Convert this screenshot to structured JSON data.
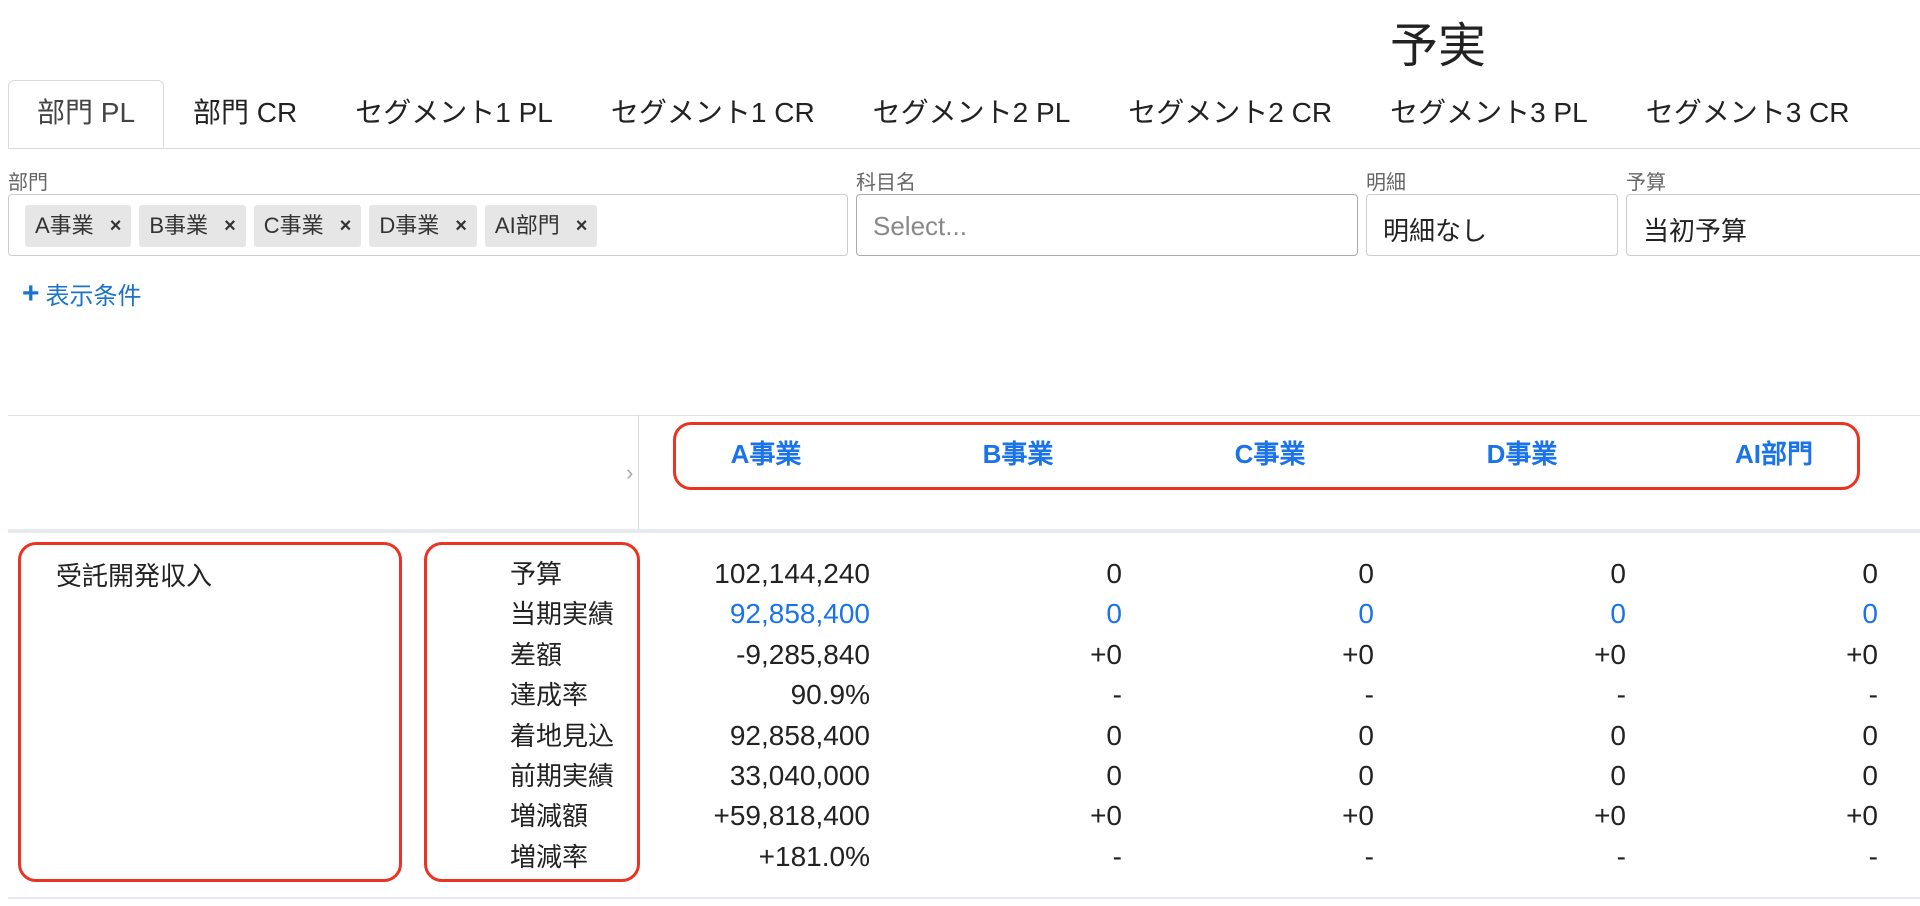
{
  "page_title": "予実",
  "tabs": [
    {
      "label": "部門 PL",
      "active": true
    },
    {
      "label": "部門 CR",
      "active": false
    },
    {
      "label": "セグメント1 PL",
      "active": false
    },
    {
      "label": "セグメント1 CR",
      "active": false
    },
    {
      "label": "セグメント2 PL",
      "active": false
    },
    {
      "label": "セグメント2 CR",
      "active": false
    },
    {
      "label": "セグメント3 PL",
      "active": false
    },
    {
      "label": "セグメント3 CR",
      "active": false
    }
  ],
  "filters": {
    "department": {
      "label": "部門",
      "chips": [
        "A事業",
        "B事業",
        "C事業",
        "D事業",
        "AI部門"
      ],
      "remove_icon": "×"
    },
    "account": {
      "label": "科目名",
      "placeholder": "Select..."
    },
    "detail": {
      "label": "明細",
      "value": "明細なし"
    },
    "budget": {
      "label": "予算",
      "value": "当初予算"
    }
  },
  "add_condition": {
    "icon": "+",
    "label": "表示条件"
  },
  "table": {
    "expand_icon": "›",
    "columns": [
      "A事業",
      "B事業",
      "C事業",
      "D事業",
      "AI部門"
    ],
    "category": "受託開発収入",
    "row_labels": [
      "予算",
      "当期実績",
      "差額",
      "達成率",
      "着地見込",
      "前期実績",
      "増減額",
      "増減率"
    ],
    "rows": [
      [
        "102,144,240",
        "0",
        "0",
        "0",
        "0"
      ],
      [
        "92,858,400",
        "0",
        "0",
        "0",
        "0"
      ],
      [
        "-9,285,840",
        "+0",
        "+0",
        "+0",
        "+0"
      ],
      [
        "90.9%",
        "-",
        "-",
        "-",
        "-"
      ],
      [
        "92,858,400",
        "0",
        "0",
        "0",
        "0"
      ],
      [
        "33,040,000",
        "0",
        "0",
        "0",
        "0"
      ],
      [
        "+59,818,400",
        "+0",
        "+0",
        "+0",
        "+0"
      ],
      [
        "+181.0%",
        "-",
        "-",
        "-",
        "-"
      ]
    ],
    "link_row_index": 1
  },
  "colors": {
    "accent": "#1a73e8",
    "highlight": "#ea3323"
  }
}
